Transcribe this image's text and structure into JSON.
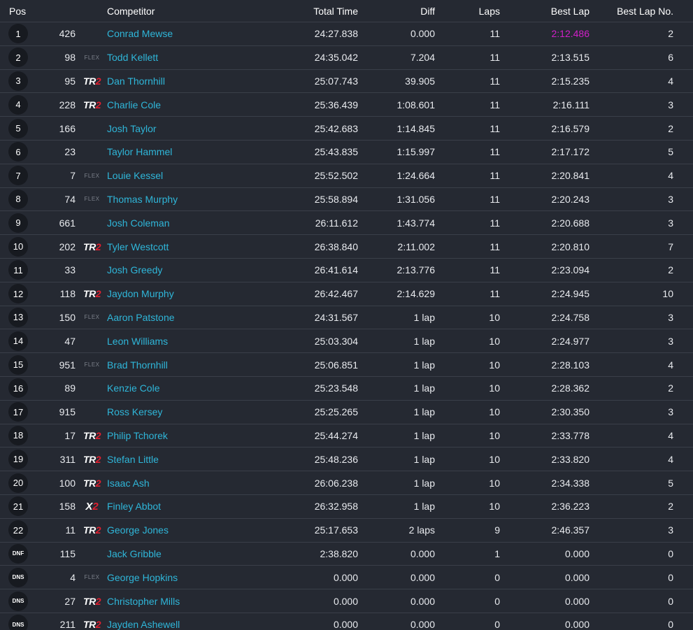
{
  "headers": {
    "pos": "Pos",
    "competitor": "Competitor",
    "total_time": "Total Time",
    "diff": "Diff",
    "laps": "Laps",
    "best_lap": "Best Lap",
    "best_lap_no": "Best Lap No."
  },
  "colors": {
    "background": "#252932",
    "name_link": "#2fb6d9",
    "fastest_lap": "#d11fc9",
    "tr2_accent": "#e01f2f"
  },
  "rows": [
    {
      "pos": "1",
      "num": "426",
      "cls": "",
      "name": "Conrad Mewse",
      "total": "24:27.838",
      "diff": "0.000",
      "laps": "11",
      "best": "2:12.486",
      "bestno": "2"
    },
    {
      "pos": "2",
      "num": "98",
      "cls": "FLEX",
      "name": "Todd Kellett",
      "total": "24:35.042",
      "diff": "7.204",
      "laps": "11",
      "best": "2:13.515",
      "bestno": "6"
    },
    {
      "pos": "3",
      "num": "95",
      "cls": "TR2",
      "name": "Dan Thornhill",
      "total": "25:07.743",
      "diff": "39.905",
      "laps": "11",
      "best": "2:15.235",
      "bestno": "4"
    },
    {
      "pos": "4",
      "num": "228",
      "cls": "TR2",
      "name": "Charlie Cole",
      "total": "25:36.439",
      "diff": "1:08.601",
      "laps": "11",
      "best": "2:16.111",
      "bestno": "3"
    },
    {
      "pos": "5",
      "num": "166",
      "cls": "",
      "name": "Josh Taylor",
      "total": "25:42.683",
      "diff": "1:14.845",
      "laps": "11",
      "best": "2:16.579",
      "bestno": "2"
    },
    {
      "pos": "6",
      "num": "23",
      "cls": "",
      "name": "Taylor Hammel",
      "total": "25:43.835",
      "diff": "1:15.997",
      "laps": "11",
      "best": "2:17.172",
      "bestno": "5"
    },
    {
      "pos": "7",
      "num": "7",
      "cls": "FLEX",
      "name": "Louie Kessel",
      "total": "25:52.502",
      "diff": "1:24.664",
      "laps": "11",
      "best": "2:20.841",
      "bestno": "4"
    },
    {
      "pos": "8",
      "num": "74",
      "cls": "FLEX",
      "name": "Thomas Murphy",
      "total": "25:58.894",
      "diff": "1:31.056",
      "laps": "11",
      "best": "2:20.243",
      "bestno": "3"
    },
    {
      "pos": "9",
      "num": "661",
      "cls": "",
      "name": "Josh Coleman",
      "total": "26:11.612",
      "diff": "1:43.774",
      "laps": "11",
      "best": "2:20.688",
      "bestno": "3"
    },
    {
      "pos": "10",
      "num": "202",
      "cls": "TR2",
      "name": "Tyler Westcott",
      "total": "26:38.840",
      "diff": "2:11.002",
      "laps": "11",
      "best": "2:20.810",
      "bestno": "7"
    },
    {
      "pos": "11",
      "num": "33",
      "cls": "",
      "name": "Josh Greedy",
      "total": "26:41.614",
      "diff": "2:13.776",
      "laps": "11",
      "best": "2:23.094",
      "bestno": "2"
    },
    {
      "pos": "12",
      "num": "118",
      "cls": "TR2",
      "name": "Jaydon Murphy",
      "total": "26:42.467",
      "diff": "2:14.629",
      "laps": "11",
      "best": "2:24.945",
      "bestno": "10"
    },
    {
      "pos": "13",
      "num": "150",
      "cls": "FLEX",
      "name": "Aaron Patstone",
      "total": "24:31.567",
      "diff": "1 lap",
      "laps": "10",
      "best": "2:24.758",
      "bestno": "3"
    },
    {
      "pos": "14",
      "num": "47",
      "cls": "",
      "name": "Leon Williams",
      "total": "25:03.304",
      "diff": "1 lap",
      "laps": "10",
      "best": "2:24.977",
      "bestno": "3"
    },
    {
      "pos": "15",
      "num": "951",
      "cls": "FLEX",
      "name": "Brad Thornhill",
      "total": "25:06.851",
      "diff": "1 lap",
      "laps": "10",
      "best": "2:28.103",
      "bestno": "4"
    },
    {
      "pos": "16",
      "num": "89",
      "cls": "",
      "name": "Kenzie Cole",
      "total": "25:23.548",
      "diff": "1 lap",
      "laps": "10",
      "best": "2:28.362",
      "bestno": "2"
    },
    {
      "pos": "17",
      "num": "915",
      "cls": "",
      "name": "Ross Kersey",
      "total": "25:25.265",
      "diff": "1 lap",
      "laps": "10",
      "best": "2:30.350",
      "bestno": "3"
    },
    {
      "pos": "18",
      "num": "17",
      "cls": "TR2",
      "name": "Philip Tchorek",
      "total": "25:44.274",
      "diff": "1 lap",
      "laps": "10",
      "best": "2:33.778",
      "bestno": "4"
    },
    {
      "pos": "19",
      "num": "311",
      "cls": "TR2",
      "name": "Stefan Little",
      "total": "25:48.236",
      "diff": "1 lap",
      "laps": "10",
      "best": "2:33.820",
      "bestno": "4"
    },
    {
      "pos": "20",
      "num": "100",
      "cls": "TR2",
      "name": "Isaac Ash",
      "total": "26:06.238",
      "diff": "1 lap",
      "laps": "10",
      "best": "2:34.338",
      "bestno": "5"
    },
    {
      "pos": "21",
      "num": "158",
      "cls": "X2",
      "name": "Finley Abbot",
      "total": "26:32.958",
      "diff": "1 lap",
      "laps": "10",
      "best": "2:36.223",
      "bestno": "2"
    },
    {
      "pos": "22",
      "num": "11",
      "cls": "TR2",
      "name": "George Jones",
      "total": "25:17.653",
      "diff": "2 laps",
      "laps": "9",
      "best": "2:46.357",
      "bestno": "3"
    },
    {
      "pos": "DNF",
      "num": "115",
      "cls": "",
      "name": "Jack Gribble",
      "total": "2:38.820",
      "diff": "0.000",
      "laps": "1",
      "best": "0.000",
      "bestno": "0"
    },
    {
      "pos": "DNS",
      "num": "4",
      "cls": "FLEX",
      "name": "George Hopkins",
      "total": "0.000",
      "diff": "0.000",
      "laps": "0",
      "best": "0.000",
      "bestno": "0"
    },
    {
      "pos": "DNS",
      "num": "27",
      "cls": "TR2",
      "name": "Christopher Mills",
      "total": "0.000",
      "diff": "0.000",
      "laps": "0",
      "best": "0.000",
      "bestno": "0"
    },
    {
      "pos": "DNS",
      "num": "211",
      "cls": "TR2",
      "name": "Jayden Ashewell",
      "total": "0.000",
      "diff": "0.000",
      "laps": "0",
      "best": "0.000",
      "bestno": "0"
    }
  ]
}
